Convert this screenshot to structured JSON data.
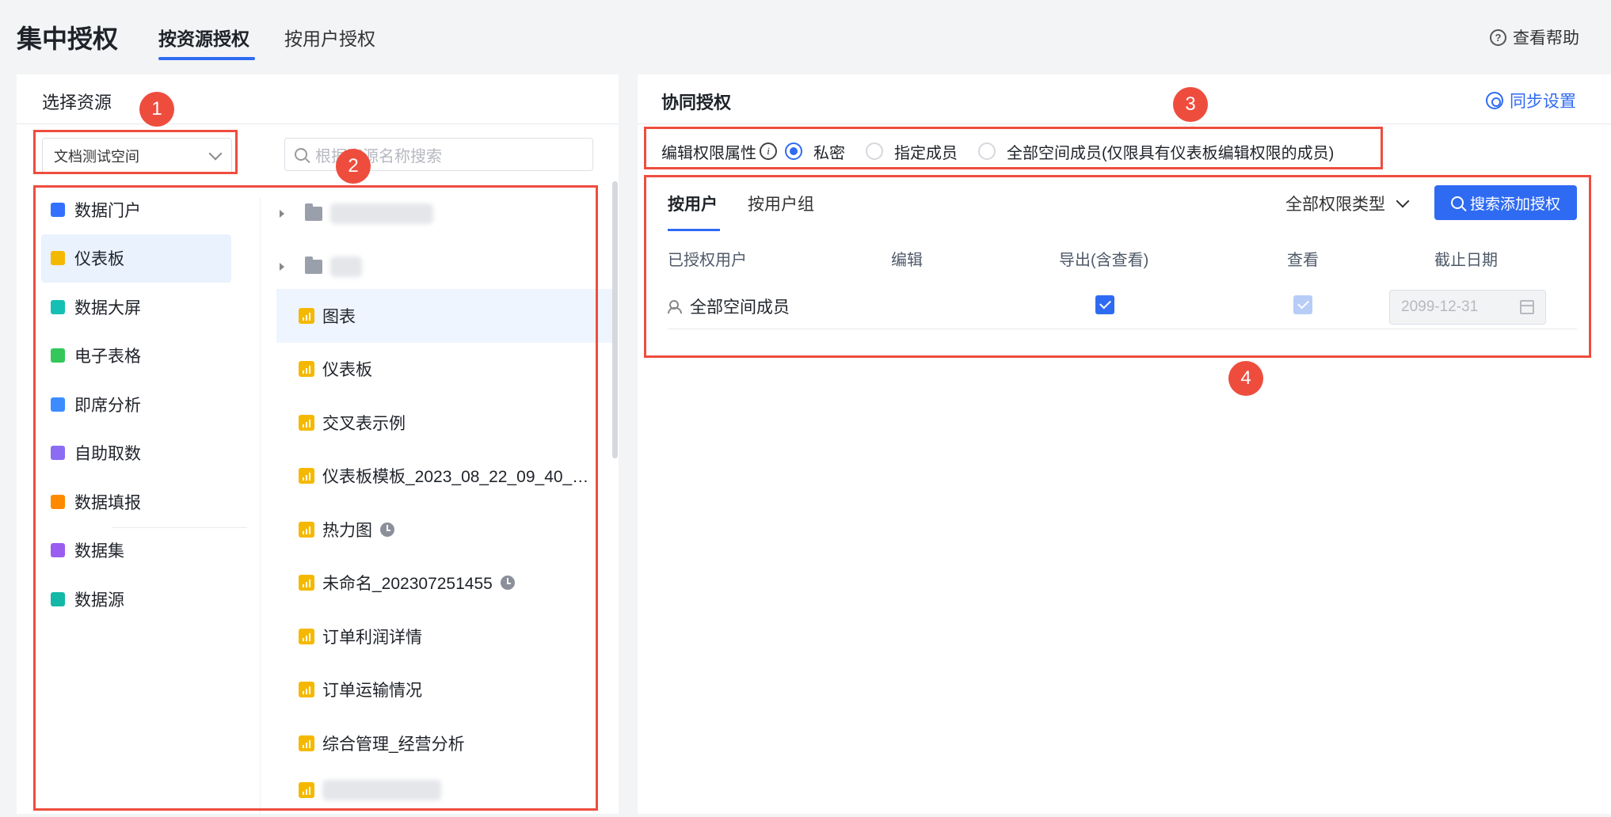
{
  "header": {
    "app_title": "集中授权",
    "tabs": [
      {
        "label": "按资源授权",
        "active": true
      },
      {
        "label": "按用户授权",
        "active": false
      }
    ],
    "help_label": "查看帮助"
  },
  "left": {
    "title": "选择资源",
    "space_select": "文档测试空间",
    "search_placeholder": "根据资源名称搜索",
    "types": [
      {
        "label": "数据门户",
        "icon": "portal-icon",
        "color": "#3370ff"
      },
      {
        "label": "仪表板",
        "icon": "dashboard-icon",
        "color": "#f5b800",
        "active": true
      },
      {
        "label": "数据大屏",
        "icon": "screen-icon",
        "color": "#14c0b3"
      },
      {
        "label": "电子表格",
        "icon": "spreadsheet-icon",
        "color": "#34c759"
      },
      {
        "label": "即席分析",
        "icon": "adhoc-icon",
        "color": "#3c8cff"
      },
      {
        "label": "自助取数",
        "icon": "selfservice-icon",
        "color": "#8c6cf2"
      },
      {
        "label": "数据填报",
        "icon": "form-icon",
        "color": "#ff8a00"
      },
      {
        "label": "数据集",
        "icon": "dataset-icon",
        "color": "#9b5cf0"
      },
      {
        "label": "数据源",
        "icon": "datasource-icon",
        "color": "#14b8a6"
      }
    ],
    "resources": [
      {
        "label": "图表",
        "active": true
      },
      {
        "label": "仪表板"
      },
      {
        "label": "交叉表示例"
      },
      {
        "label": "仪表板模板_2023_08_22_09_40_…"
      },
      {
        "label": "热力图",
        "scheduled": true
      },
      {
        "label": "未命名_202307251455",
        "scheduled": true
      },
      {
        "label": "订单利润详情"
      },
      {
        "label": "订单运输情况"
      },
      {
        "label": "综合管理_经营分析"
      }
    ]
  },
  "right": {
    "title": "协同授权",
    "sync_label": "同步设置",
    "perm_attr_label": "编辑权限属性",
    "perm_options": [
      {
        "label": "私密",
        "checked": true
      },
      {
        "label": "指定成员",
        "checked": false
      },
      {
        "label": "全部空间成员(仅限具有仪表板编辑权限的成员)",
        "checked": false
      }
    ],
    "subtabs": [
      {
        "label": "按用户",
        "active": true
      },
      {
        "label": "按用户组",
        "active": false
      }
    ],
    "perm_type_label": "全部权限类型",
    "add_button": "搜索添加授权",
    "table": {
      "headers": [
        "已授权用户",
        "编辑",
        "导出(含查看)",
        "查看",
        "截止日期"
      ],
      "rows": [
        {
          "user": "全部空间成员",
          "edit": false,
          "export": true,
          "view": true,
          "date": "2099-12-31"
        }
      ]
    }
  },
  "annotations": [
    "1",
    "2",
    "3",
    "4"
  ],
  "accent_color": "#2f6bf2",
  "annotation_color": "#ee4d3e"
}
